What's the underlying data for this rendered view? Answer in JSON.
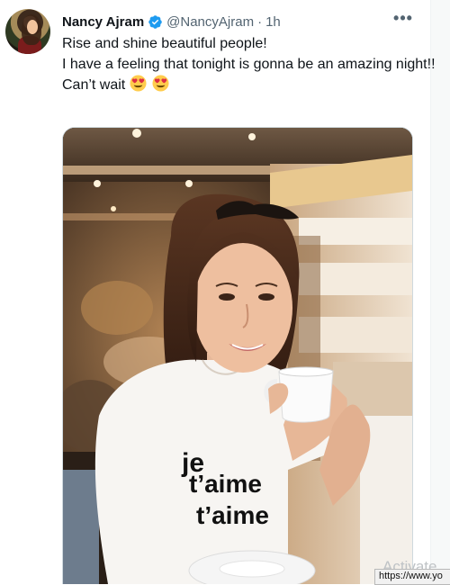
{
  "tweet": {
    "display_name": "Nancy Ajram",
    "handle": "@NancyAjram",
    "separator": "·",
    "time": "1h",
    "more_label": "•••",
    "lines": [
      "Rise and shine beautiful people!",
      "I have a feeling that tonight is gonna be an amazing night!!",
      "Can’t wait"
    ],
    "emoji": [
      "smiling-face-with-heart-eyes",
      "smiling-face-with-heart-eyes"
    ]
  },
  "photo": {
    "shirt_lines": [
      "je",
      "t’aime",
      "t’aime"
    ]
  },
  "overlay": {
    "watermark": "Activate",
    "status_url": "https://www.yo"
  },
  "colors": {
    "verified": "#1d9bf0",
    "text": "#0f1419",
    "secondary": "#536471"
  }
}
